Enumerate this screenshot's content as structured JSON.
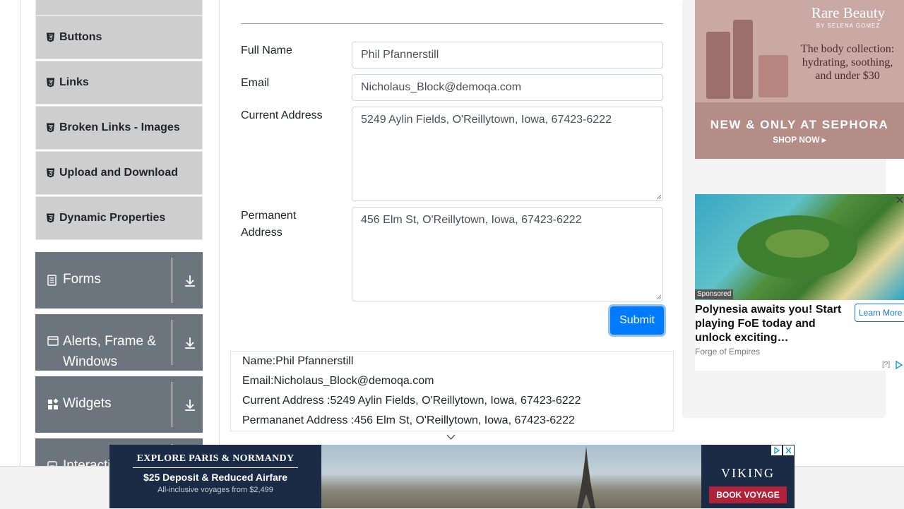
{
  "sidebar": {
    "sub_items": [
      "Buttons",
      "Links",
      "Broken Links - Images",
      "Upload and Download",
      "Dynamic Properties"
    ],
    "groups": {
      "forms": "Forms",
      "alerts": "Alerts, Frame & Windows",
      "widgets": "Widgets",
      "interactions": "Interactions"
    }
  },
  "form": {
    "full_name_label": "Full Name",
    "full_name_value": "Phil Pfannerstill",
    "email_label": "Email",
    "email_value": "Nicholaus_Block@demoqa.com",
    "current_address_label": "Current Address",
    "current_address_value": "5249 Aylin Fields, O'Reillytown, Iowa, 67423-6222",
    "permanent_address_label": "Permanent Address",
    "permanent_address_value": "456 Elm St, O'Reillytown, Iowa, 67423-6222",
    "submit_label": "Submit"
  },
  "output": {
    "name": "Name:Phil Pfannerstill",
    "email": "Email:Nicholaus_Block@demoqa.com",
    "current_address": "Current Address :5249 Aylin Fields, O'Reillytown, Iowa, 67423-6222",
    "permanent_address": "Permananet Address :456 Elm St, O'Reillytown, Iowa, 67423-6222"
  },
  "ads": {
    "rare_beauty": {
      "brand": "Rare Beauty",
      "brand_sub": "BY SELENA GOMEZ",
      "tagline": "The body collection: hydrating, soothing, and under $30",
      "headline": "NEW & ONLY AT SEPHORA",
      "cta": "SHOP NOW ▸"
    },
    "sponsored": {
      "badge": "Sponsored",
      "headline": "Polynesia awaits you! Start playing FoE today and unlock exciting…",
      "source": "Forge of Empires",
      "cta": "Learn More",
      "info": "[?]"
    },
    "viking": {
      "headline": "EXPLORE PARIS & NORMANDY",
      "offer": "$25 Deposit & Reduced Airfare",
      "subline": "All-inclusive voyages from $2,499",
      "brand": "VIKING",
      "cta": "BOOK VOYAGE"
    }
  },
  "colors": {
    "primary": "#007bff",
    "sidebar_group": "#6c757d",
    "sidebar_item": "#cecece"
  }
}
